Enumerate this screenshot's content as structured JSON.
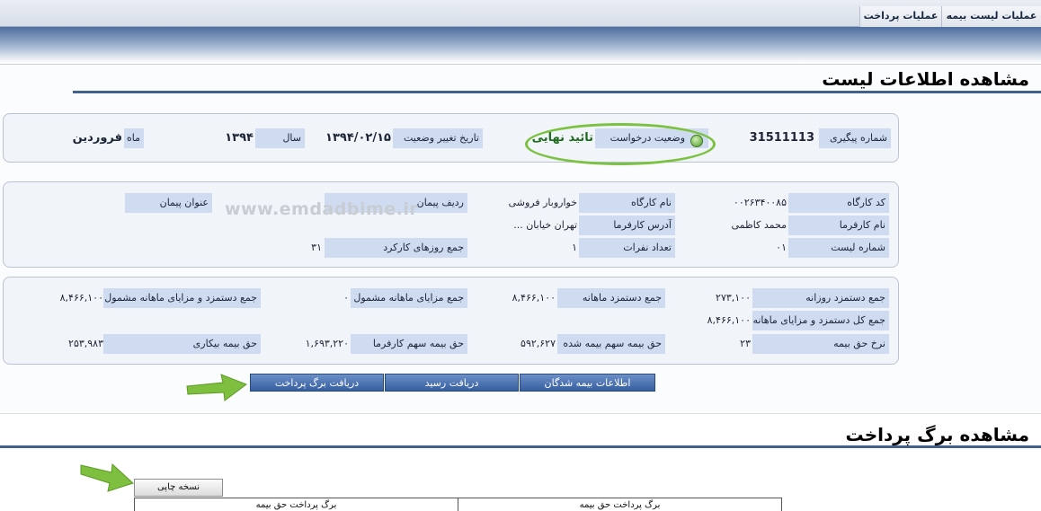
{
  "topnav": {
    "tabs": [
      {
        "label": "عملیات لیست بیمه"
      },
      {
        "label": "عملیات پرداخت"
      }
    ]
  },
  "list_info": {
    "title": "مشاهده اطلاعات لیست",
    "status_panel": {
      "tracking_label": "شماره پیگیری",
      "tracking_value": "31511113",
      "request_status_label": "وضعیت درخواست",
      "request_status_value": "تائید نهایی",
      "status_change_date_label": "تاریخ تغییر وضعیت",
      "status_change_date_value": "۱۳۹۴/۰۲/۱۵",
      "year_label": "سال",
      "year_value": "۱۳۹۴",
      "month_label": "ماه",
      "month_value": "فروردین"
    },
    "workshop_panel": {
      "workshop_code_label": "کد کارگاه",
      "workshop_code_value": "۰۰۲۶۳۴۰۰۸۵",
      "workshop_name_label": "نام کارگاه",
      "workshop_name_value": "خواروبار فروشی",
      "contract_row_label": "ردیف پیمان",
      "contract_row_value": "",
      "contract_title_label": "عنوان پیمان",
      "contract_title_value": "",
      "employer_name_label": "نام کارفرما",
      "employer_name_value": "محمد کاظمی",
      "employer_address_label": "آدرس کارفرما",
      "employer_address_value": "تهران خیابان ...",
      "list_number_label": "شماره لیست",
      "list_number_value": "۰۱",
      "people_count_label": "تعداد نفرات",
      "people_count_value": "۱",
      "work_days_label": "جمع روزهای کارکرد",
      "work_days_value": "۳۱"
    },
    "wages_panel": {
      "daily_wage_label": "جمع دستمزد روزانه",
      "daily_wage_value": "۲۷۳,۱۰۰",
      "monthly_wage_label": "جمع دستمزد ماهانه",
      "monthly_wage_value": "۸,۴۶۶,۱۰۰",
      "monthly_benefits_label": "جمع مزایای ماهانه مشمول",
      "monthly_benefits_value": "۰",
      "wage_benefits_label": "جمع دستمزد و مزایای ماهانه مشمول",
      "wage_benefits_value": "۸,۴۶۶,۱۰۰",
      "total_wage_benefits_label": "جمع کل دستمزد و مزایای ماهانه",
      "total_wage_benefits_value": "۸,۴۶۶,۱۰۰",
      "insurance_rate_label": "نرخ حق بیمه",
      "insurance_rate_value": "۲۳",
      "insured_share_label": "حق بیمه سهم بیمه شده",
      "insured_share_value": "۵۹۲,۶۲۷",
      "employer_share_label": "حق بیمه سهم کارفرما",
      "employer_share_value": "۱,۶۹۳,۲۲۰",
      "unemployment_label": "حق بیمه بیکاری",
      "unemployment_value": "۲۵۳,۹۸۳"
    },
    "buttons": {
      "insured_info": "اطلاعات بیمه شدگان",
      "get_receipt": "دریافت رسید",
      "get_payment_slip": "دریافت برگ پرداخت"
    },
    "watermark": "www.emdadbime.ir"
  },
  "payment_slip": {
    "title": "مشاهده برگ پرداخت",
    "print_button": "نسخه چاپی",
    "table_headers": [
      "برگ پرداخت حق بیمه",
      "برگ پرداخت حق بیمه"
    ]
  },
  "colors": {
    "accent_green": "#7cc242",
    "label_bg": "#cfdbf0",
    "button_blue": "#355f9f"
  }
}
